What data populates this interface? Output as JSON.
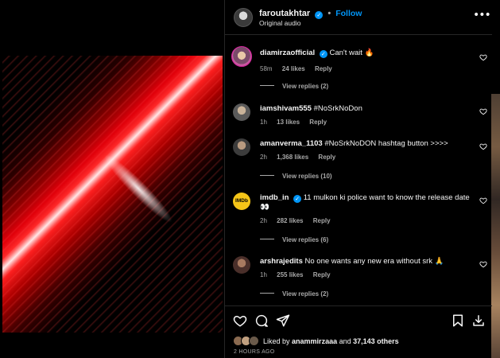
{
  "post": {
    "author": "faroutakhtar",
    "follow_label": "Follow",
    "separator": "•",
    "audio": "Original audio",
    "more_label": "•••"
  },
  "comments": [
    {
      "user": "diamirzaofficial",
      "verified": true,
      "text": "Can't wait 🔥",
      "time": "58m",
      "likes": "24 likes",
      "reply_label": "Reply",
      "view_replies": "View replies (2)"
    },
    {
      "user": "iamshivam555",
      "verified": false,
      "text": "#NoSrkNoDon",
      "time": "1h",
      "likes": "13 likes",
      "reply_label": "Reply",
      "view_replies": ""
    },
    {
      "user": "amanverma_1103",
      "verified": false,
      "text": "#NoSrkNoDON hashtag button >>>>",
      "time": "2h",
      "likes": "1,368 likes",
      "reply_label": "Reply",
      "view_replies": "View replies (10)"
    },
    {
      "user": "imdb_in",
      "verified": true,
      "text": "11 mulkon ki police want to know the release date 👀",
      "time": "2h",
      "likes": "282 likes",
      "reply_label": "Reply",
      "view_replies": "View replies (6)",
      "avatar_label": "IMDb"
    },
    {
      "user": "arshrajedits",
      "verified": false,
      "text": "No one wants any new era without srk 🙏",
      "time": "1h",
      "likes": "255 likes",
      "reply_label": "Reply",
      "view_replies": "View replies (2)"
    }
  ],
  "liked": {
    "prefix": "Liked by",
    "user": "anammirzaaa",
    "and": "and",
    "others": "37,143 others"
  },
  "time_ago": "2 HOURS AGO",
  "icons": {
    "like": "heart-icon",
    "comment": "comment-icon",
    "share": "send-icon",
    "save": "bookmark-icon",
    "download": "download-icon"
  },
  "colors": {
    "accent": "#0095f6",
    "background": "#000000",
    "muted_text": "#a8a8a8"
  }
}
